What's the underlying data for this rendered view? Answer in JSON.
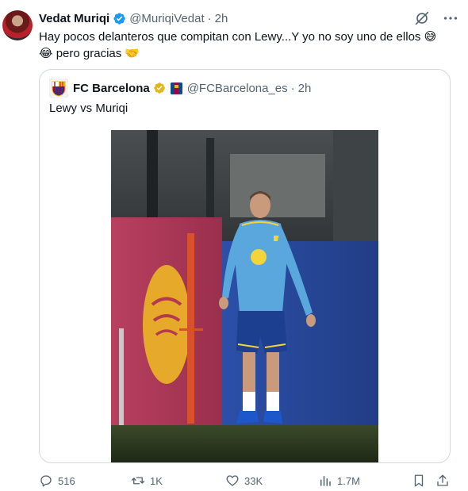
{
  "author": {
    "display_name": "Vedat Muriqi",
    "handle": "@MuriqiVedat",
    "separator": "·",
    "time": "2h"
  },
  "tweet": {
    "text_line1": "Hay pocos delanteros que compitan con Lewy...Y yo no soy uno de ellos",
    "emoji_sweat": "😅",
    "emoji_laugh": "😂",
    "text_line2": "pero gracias",
    "emoji_handshake": "🤝"
  },
  "quote": {
    "display_name": "FC Barcelona",
    "handle": "@FCBarcelona_es",
    "separator": "·",
    "time": "2h",
    "text": "Lewy vs Muriqi"
  },
  "actions": {
    "replies": "516",
    "reposts": "1K",
    "likes": "33K",
    "views": "1.7M"
  },
  "icons": {
    "verified": "verified-badge-icon",
    "gold_check": "gold-verified-badge-icon",
    "grok": "grok-icon",
    "more": "more-icon",
    "reply": "reply-icon",
    "repost": "repost-icon",
    "like": "heart-icon",
    "views": "views-icon",
    "bookmark": "bookmark-icon",
    "share": "share-icon"
  },
  "colors": {
    "text": "#0f1419",
    "muted": "#536471",
    "verified_blue": "#1d9bf0",
    "gold": "#e2b719",
    "border": "#cfd9de"
  }
}
